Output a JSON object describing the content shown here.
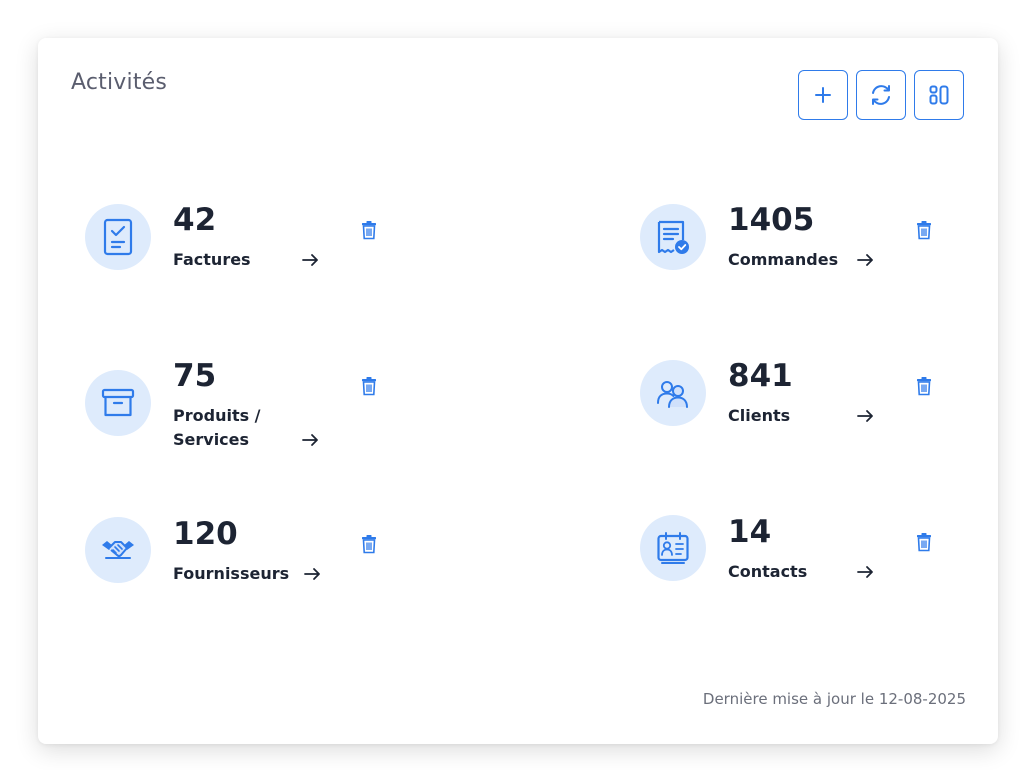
{
  "card": {
    "title": "Activités",
    "footer_text": "Dernière mise à jour le 12-08-2025"
  },
  "toolbar": {
    "buttons": [
      {
        "name": "add",
        "icon": "plus-icon"
      },
      {
        "name": "refresh",
        "icon": "refresh-icon"
      },
      {
        "name": "layout",
        "icon": "layout-icon"
      }
    ]
  },
  "items": [
    {
      "count": "42",
      "label": "Factures",
      "icon": "invoice-icon"
    },
    {
      "count": "1405",
      "label": "Commandes",
      "icon": "order-icon"
    },
    {
      "count": "75",
      "label_line1": "Produits /",
      "label_line2": "Services",
      "icon": "box-icon"
    },
    {
      "count": "841",
      "label": "Clients",
      "icon": "users-icon"
    },
    {
      "count": "120",
      "label": "Fournisseurs",
      "icon": "handshake-icon"
    },
    {
      "count": "14",
      "label": "Contacts",
      "icon": "contact-card-icon"
    }
  ],
  "colors": {
    "accent": "#2f7bea",
    "icon_bg": "#deebfc",
    "text_dark": "#1d2433",
    "text_muted": "#6b6f7b"
  }
}
